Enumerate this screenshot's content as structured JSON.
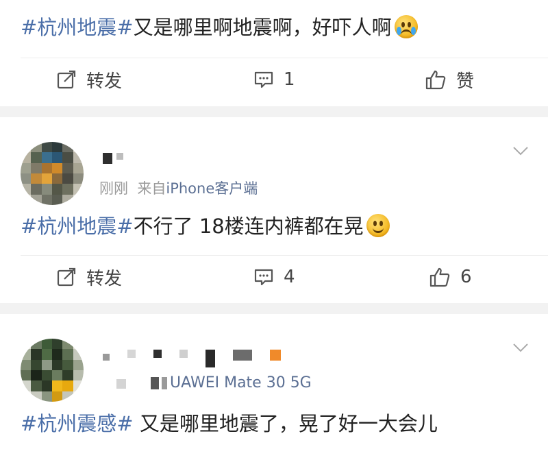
{
  "posts": [
    {
      "tag": "#杭州地震#",
      "body": "又是哪里啊地震啊，好吓人啊",
      "emoji": "crying-face",
      "actions": {
        "repost_label": "转发",
        "comment_count": "1",
        "like_label": "赞"
      }
    },
    {
      "time": "刚刚",
      "source_prefix": "来自",
      "source": "iPhone客户端",
      "tag": "#杭州地震#",
      "body": "不行了 18楼连内裤都在晃",
      "emoji": "smiling-face",
      "actions": {
        "repost_label": "转发",
        "comment_count": "4",
        "like_count": "6"
      }
    },
    {
      "source": "HUAWEI Mate 30 5G",
      "source_partial": "UAWEI Mate 30 5G",
      "tag": "#杭州震感#",
      "body": " 又是哪里地震了，晃了好一大会儿"
    }
  ],
  "colors": {
    "topic_link": "#4a6ea8",
    "text": "#222222",
    "meta": "#9a9a9a",
    "separator": "#f2f2f2"
  }
}
